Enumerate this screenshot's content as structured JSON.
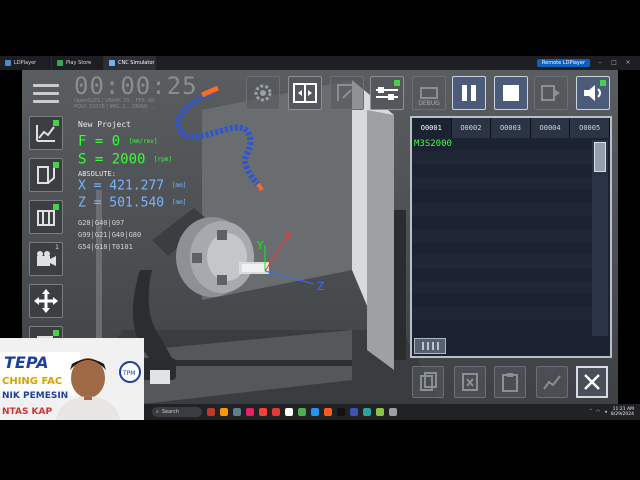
{
  "os": {
    "tabs": [
      {
        "label": "LDPlayer",
        "active": false
      },
      {
        "label": "Play Store",
        "active": false
      },
      {
        "label": "CNC Simulator",
        "active": true
      }
    ],
    "remote_label": "Remote LDPlayer"
  },
  "status": {
    "timer": "00:00:25",
    "gl_info_1": "OpenGLES | VRAM: 70... FPS: 60",
    "gl_info_2": "POLY: 32078 | IMG: 2... DRAW: ..."
  },
  "machine": {
    "project_name": "New Project",
    "feed_label": "F = 0",
    "feed_unit": "[mm/rev]",
    "speed_label": "S = 2000",
    "speed_unit": "[rpm]",
    "coord_mode": "ABSOLUTE:",
    "x_label": "X = 421.277",
    "x_unit": "[mm]",
    "z_label": "Z = 501.540",
    "z_unit": "[mm]",
    "gcode_lines": [
      "G28|G40|G97",
      "G99|G21|G40|G80",
      "G54|G18|T0101"
    ]
  },
  "toolbar": {
    "debug_label": "DEBUG"
  },
  "program": {
    "tabs": [
      "O0001",
      "O0002",
      "O0003",
      "O0004",
      "O0005"
    ],
    "active_tab": 0,
    "lines": [
      "M3S2000",
      "",
      "",
      "",
      "",
      "",
      "",
      "",
      "",
      "",
      "",
      "",
      "",
      "",
      ""
    ]
  },
  "axes": {
    "x": "X",
    "y": "Y",
    "z": "Z"
  },
  "webcam": {
    "banner_line1": "TEPA",
    "banner_line2": "CHING FAC",
    "banner_line3": "NIK PEMESIN",
    "banner_line4": "NTAS KAP",
    "logo_text": "TPM"
  },
  "taskbar": {
    "search_placeholder": "Search",
    "time": "11:21 AM",
    "date": "8/29/2024"
  },
  "colors": {
    "feed_green": "#33ff33",
    "coord_blue": "#7ab4ff",
    "program_green": "#42ff42",
    "accent_green": "#4ad14a"
  }
}
